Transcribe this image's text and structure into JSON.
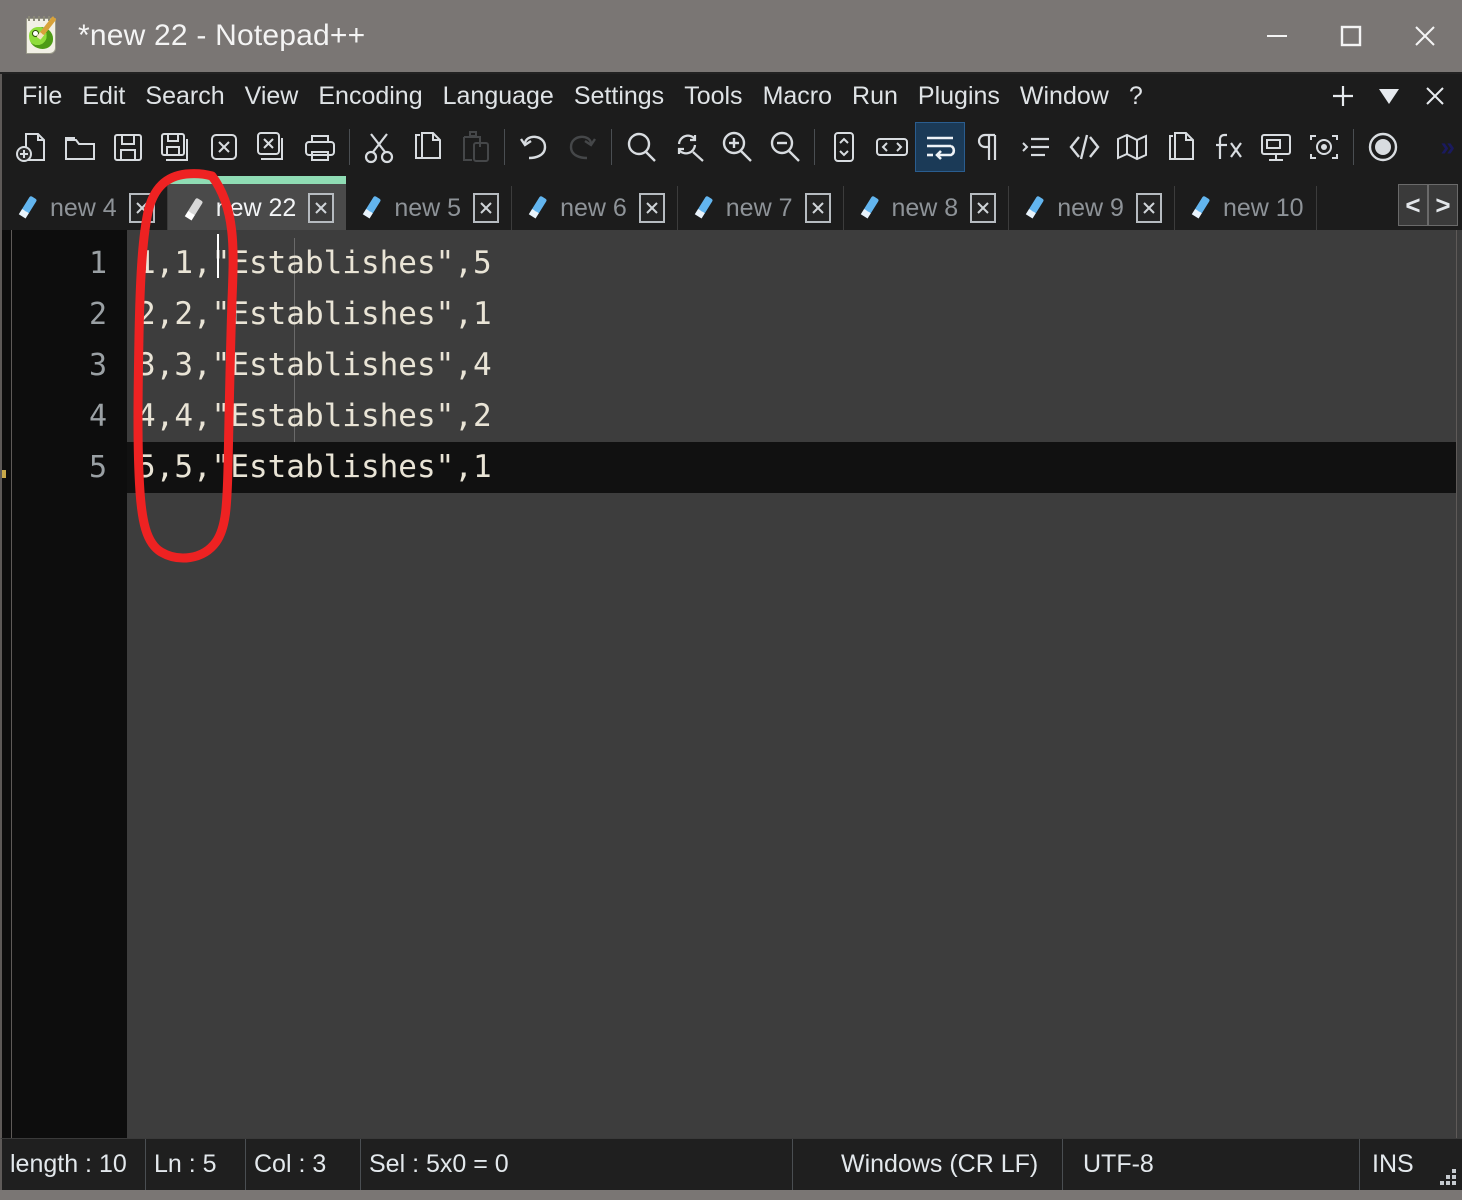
{
  "window": {
    "title": "*new 22 - Notepad++",
    "icon": "notepad-plus-plus-icon",
    "controls": {
      "minimize": "minimize-icon",
      "maximize": "maximize-icon",
      "close": "close-icon"
    },
    "titlebar_color": "#7a7674"
  },
  "menubar": {
    "items": [
      {
        "label": "File"
      },
      {
        "label": "Edit"
      },
      {
        "label": "Search"
      },
      {
        "label": "View"
      },
      {
        "label": "Encoding"
      },
      {
        "label": "Language"
      },
      {
        "label": "Settings"
      },
      {
        "label": "Tools"
      },
      {
        "label": "Macro"
      },
      {
        "label": "Run"
      },
      {
        "label": "Plugins"
      },
      {
        "label": "Window"
      },
      {
        "label": "?"
      }
    ],
    "right_buttons": [
      {
        "name": "add-tab-button",
        "glyph": "+"
      },
      {
        "name": "tab-list-dropdown",
        "glyph": "▼"
      },
      {
        "name": "close-document-button",
        "glyph": "✕"
      }
    ]
  },
  "toolbar": {
    "overflow_glyph": "»",
    "buttons": [
      {
        "name": "new-file-icon",
        "tooltip": "New",
        "state": "enabled"
      },
      {
        "name": "open-file-icon",
        "tooltip": "Open",
        "state": "enabled"
      },
      {
        "name": "save-icon",
        "tooltip": "Save",
        "state": "enabled"
      },
      {
        "name": "save-all-icon",
        "tooltip": "Save All",
        "state": "enabled"
      },
      {
        "name": "close-file-icon",
        "tooltip": "Close",
        "state": "enabled"
      },
      {
        "name": "close-all-files-icon",
        "tooltip": "Close All",
        "state": "enabled"
      },
      {
        "name": "print-icon",
        "tooltip": "Print",
        "state": "enabled"
      },
      {
        "name": "cut-icon",
        "tooltip": "Cut",
        "state": "enabled"
      },
      {
        "name": "copy-icon",
        "tooltip": "Copy",
        "state": "enabled"
      },
      {
        "name": "paste-icon",
        "tooltip": "Paste",
        "state": "disabled"
      },
      {
        "name": "undo-icon",
        "tooltip": "Undo",
        "state": "enabled"
      },
      {
        "name": "redo-icon",
        "tooltip": "Redo",
        "state": "disabled"
      },
      {
        "name": "find-icon",
        "tooltip": "Find",
        "state": "enabled"
      },
      {
        "name": "replace-icon",
        "tooltip": "Replace",
        "state": "enabled"
      },
      {
        "name": "zoom-in-icon",
        "tooltip": "Zoom In",
        "state": "enabled"
      },
      {
        "name": "zoom-out-icon",
        "tooltip": "Zoom Out",
        "state": "enabled"
      },
      {
        "name": "sync-vertical-scroll-icon",
        "tooltip": "Synchronize Vertical Scrolling",
        "state": "enabled"
      },
      {
        "name": "sync-horizontal-scroll-icon",
        "tooltip": "Synchronize Horizontal Scrolling",
        "state": "enabled"
      },
      {
        "name": "word-wrap-icon",
        "tooltip": "Word wrap",
        "state": "active"
      },
      {
        "name": "show-all-characters-icon",
        "tooltip": "Show All Characters",
        "state": "enabled"
      },
      {
        "name": "indent-guide-icon",
        "tooltip": "Show Indent Guide",
        "state": "enabled"
      },
      {
        "name": "user-defined-language-icon",
        "tooltip": "User-Defined Dialogue",
        "state": "enabled"
      },
      {
        "name": "document-map-icon",
        "tooltip": "Document Map",
        "state": "enabled"
      },
      {
        "name": "document-list-icon",
        "tooltip": "Document List",
        "state": "enabled"
      },
      {
        "name": "function-list-icon",
        "tooltip": "Function List",
        "state": "enabled"
      },
      {
        "name": "folder-as-workspace-icon",
        "tooltip": "Folder as Workspace",
        "state": "enabled"
      },
      {
        "name": "monitoring-icon",
        "tooltip": "Monitoring",
        "state": "enabled"
      },
      {
        "name": "macro-record-icon",
        "tooltip": "Start Recording",
        "state": "enabled"
      }
    ]
  },
  "tabs": {
    "items": [
      {
        "label": "new 4",
        "active": false,
        "modified": false,
        "has_close": true
      },
      {
        "label": "new 22",
        "active": true,
        "modified": true,
        "has_close": true
      },
      {
        "label": "new 5",
        "active": false,
        "modified": false,
        "has_close": true
      },
      {
        "label": "new 6",
        "active": false,
        "modified": false,
        "has_close": true
      },
      {
        "label": "new 7",
        "active": false,
        "modified": false,
        "has_close": true
      },
      {
        "label": "new 8",
        "active": false,
        "modified": false,
        "has_close": true
      },
      {
        "label": "new 9",
        "active": false,
        "modified": false,
        "has_close": true
      },
      {
        "label": "new 10",
        "active": false,
        "modified": false,
        "has_close": false
      }
    ],
    "scroll_left": "<",
    "scroll_right": ">",
    "active_indicator_color": "#8fdcb4"
  },
  "editor": {
    "line_numbers": [
      "1",
      "2",
      "3",
      "4",
      "5"
    ],
    "lines": [
      "1,1,\"Establishes\",5",
      "2,2,\"Establishes\",1",
      "3,3,\"Establishes\",4",
      "4,4,\"Establishes\",2",
      "5,5,\"Establishes\",1"
    ],
    "current_line": 5,
    "background_color": "#3d3d3d",
    "current_line_color": "#111111",
    "gutter_color": "#0d0d0d",
    "text_color": "#e9e4d6"
  },
  "annotation": {
    "type": "hand-drawn-ellipse",
    "color": "#ee2222",
    "note": "red circle around the first two numeric columns"
  },
  "statusbar": {
    "length": "length : 10",
    "line": "Ln : 5",
    "column": "Col : 3",
    "selection": "Sel : 5x0 = 0",
    "eol": "Windows (CR LF)",
    "encoding": "UTF-8",
    "insert_mode": "INS"
  }
}
